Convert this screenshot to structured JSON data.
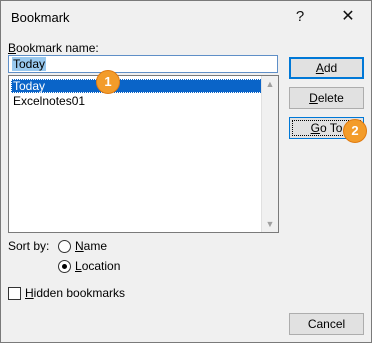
{
  "dialog": {
    "title": "Bookmark",
    "help": "?",
    "close": "✕"
  },
  "name_label": {
    "hotkey": "B",
    "rest": "ookmark name:"
  },
  "name_value": "Today",
  "list": {
    "items": [
      "Today",
      "Excelnotes01"
    ],
    "selected_index": 0
  },
  "buttons": {
    "add": {
      "hotkey": "A",
      "rest": "dd"
    },
    "delete": {
      "hotkey": "D",
      "rest": "elete"
    },
    "goto": {
      "hotkey": "G",
      "rest": "o To"
    },
    "cancel": "Cancel"
  },
  "sort": {
    "label": "Sort by:",
    "name": {
      "hotkey": "N",
      "rest": "ame"
    },
    "location": {
      "hotkey": "L",
      "rest": "ocation"
    },
    "selected": "location"
  },
  "hidden_bookmarks": {
    "hotkey": "H",
    "rest": "idden bookmarks",
    "checked": false
  },
  "annotations": {
    "one": "1",
    "two": "2"
  },
  "colors": {
    "selection": "#0a64c8",
    "accent": "#0078d7",
    "badge": "#f39c2a"
  }
}
